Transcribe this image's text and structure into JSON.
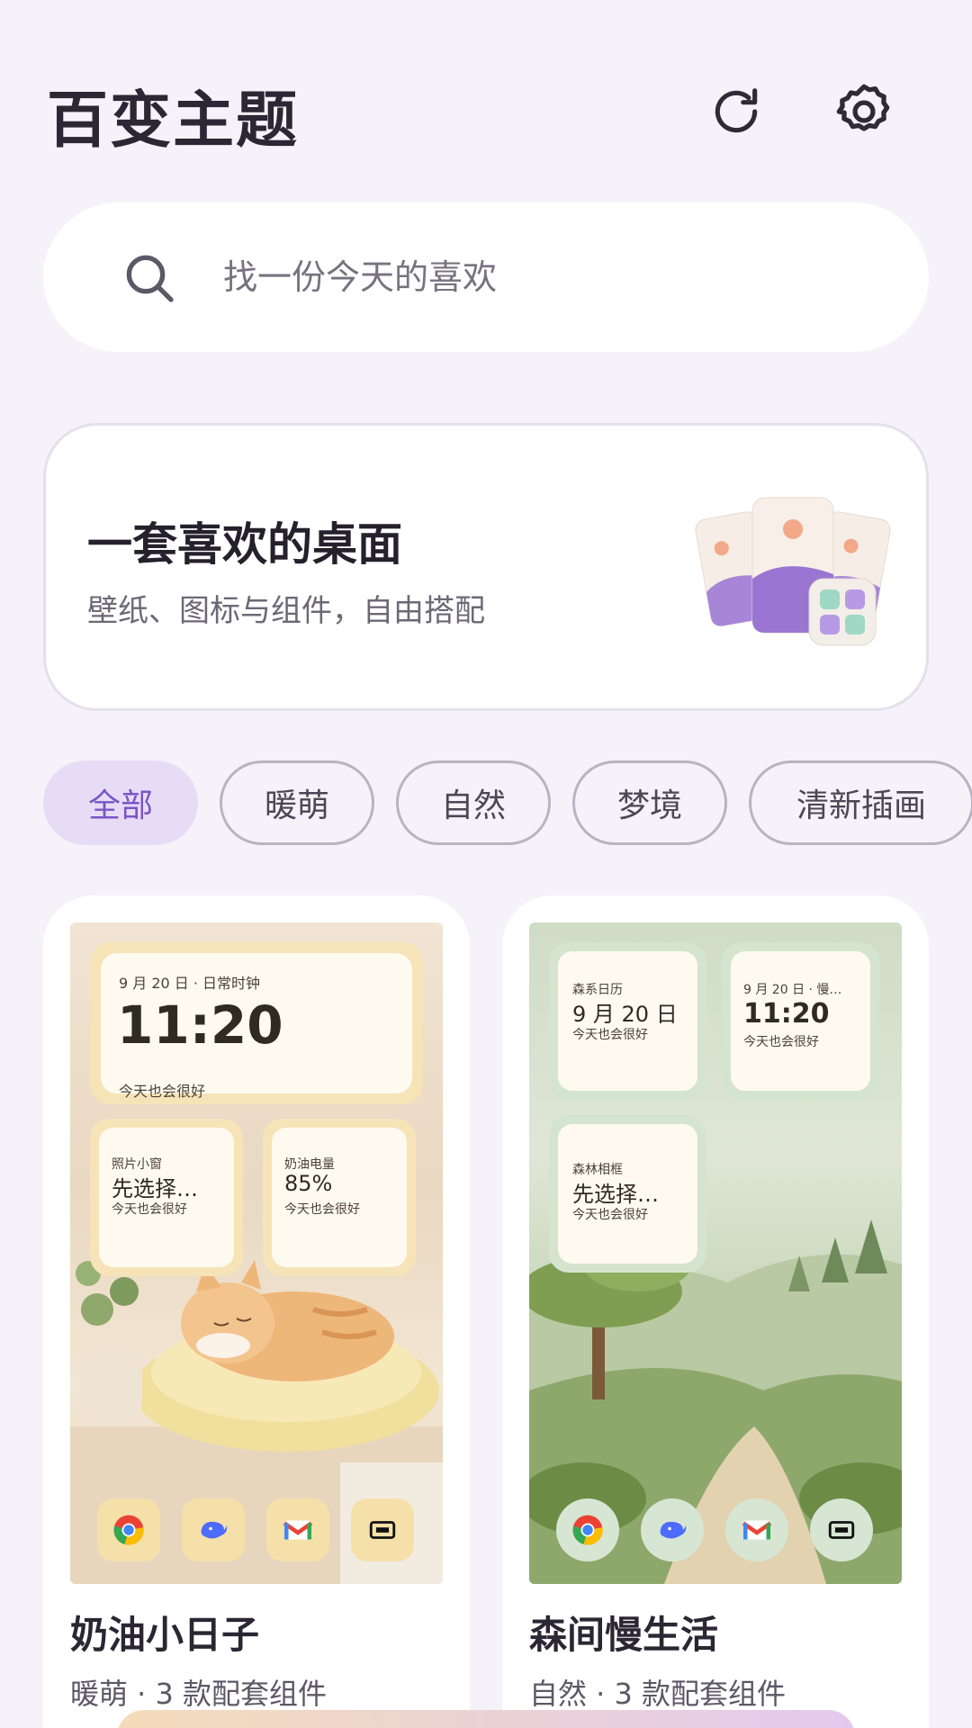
{
  "header": {
    "title": "百变主题",
    "refresh_icon": "refresh-icon",
    "settings_icon": "gear-icon"
  },
  "search": {
    "placeholder": "找一份今天的喜欢",
    "value": ""
  },
  "hero": {
    "title": "一套喜欢的桌面",
    "subtitle": "壁纸、图标与组件，自由搭配"
  },
  "categories": [
    {
      "label": "全部",
      "active": true
    },
    {
      "label": "暖萌",
      "active": false
    },
    {
      "label": "自然",
      "active": false
    },
    {
      "label": "梦境",
      "active": false
    },
    {
      "label": "清新插画",
      "active": false
    }
  ],
  "themes": [
    {
      "name": "奶油小日子",
      "meta": "暖萌 · 3 款配套组件",
      "widgets": {
        "clock": {
          "date": "9 月 20 日 · 日常时钟",
          "time": "11:20",
          "caption": "今天也会很好"
        },
        "photo": {
          "label": "照片小窗",
          "value": "先选择…",
          "caption": "今天也会很好"
        },
        "battery": {
          "label": "奶油电量",
          "value": "85%",
          "caption": "今天也会很好"
        }
      },
      "accent": "#f6e4b8"
    },
    {
      "name": "森间慢生活",
      "meta": "自然 · 3 款配套组件",
      "widgets": {
        "calendar": {
          "label": "森系日历",
          "value": "9 月 20 日",
          "caption": "今天也会很好"
        },
        "clock": {
          "date": "9 月 20 日 · 慢…",
          "time": "11:20",
          "caption": "今天也会很好"
        },
        "frame": {
          "label": "森林相框",
          "value": "先选择…",
          "caption": "今天也会很好"
        }
      },
      "accent": "#d5e4cf"
    }
  ],
  "dock_icons": [
    "chrome-icon",
    "whale-app-icon",
    "gmail-icon",
    "cassette-app-icon"
  ],
  "colors": {
    "accent": "#7a55c6",
    "chip_active_bg": "#e7dcf6",
    "background": "#f5f3f9"
  }
}
